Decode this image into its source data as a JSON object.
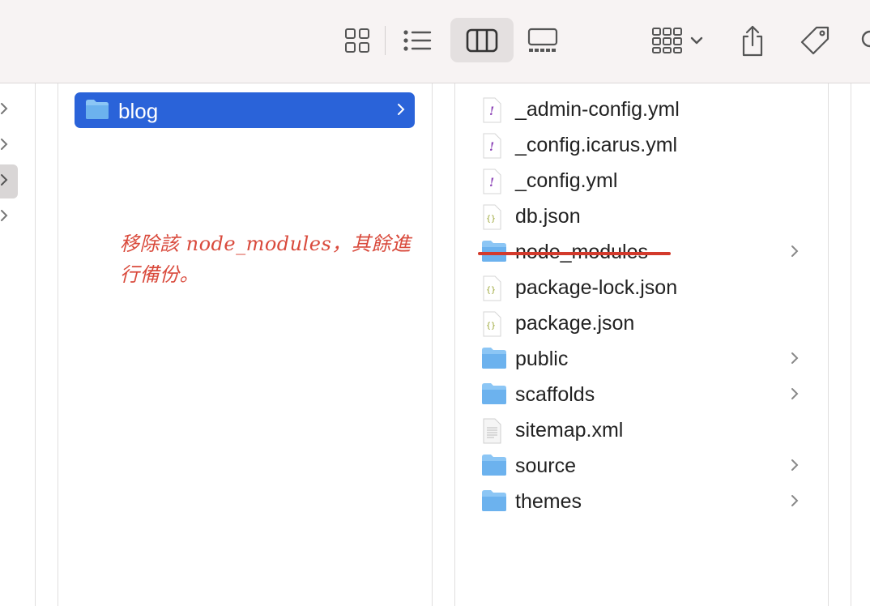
{
  "toolbar": {
    "buttons": [
      {
        "name": "icon-view-button",
        "icon": "grid-icon"
      },
      {
        "name": "list-view-button",
        "icon": "list-icon"
      },
      {
        "name": "column-view-button",
        "icon": "columns-icon",
        "active": true
      },
      {
        "name": "gallery-view-button",
        "icon": "gallery-icon"
      },
      {
        "name": "group-button",
        "icon": "group-grid-icon"
      },
      {
        "name": "share-button",
        "icon": "share-icon"
      },
      {
        "name": "tag-button",
        "icon": "tag-icon"
      }
    ]
  },
  "middle_column": {
    "selected_folder": "blog"
  },
  "annotation": {
    "line1": "移除該 node_modules，其餘進",
    "line2": "行備份。",
    "color": "#d94a3c"
  },
  "files": [
    {
      "name": "_admin-config.yml",
      "icon": "yml-file-icon",
      "folder": false
    },
    {
      "name": "_config.icarus.yml",
      "icon": "yml-file-icon",
      "folder": false
    },
    {
      "name": "_config.yml",
      "icon": "yml-file-icon",
      "folder": false
    },
    {
      "name": "db.json",
      "icon": "json-file-icon",
      "folder": false
    },
    {
      "name": "node_modules",
      "icon": "folder-icon",
      "folder": true,
      "struck": true
    },
    {
      "name": "package-lock.json",
      "icon": "json-file-icon",
      "folder": false
    },
    {
      "name": "package.json",
      "icon": "json-file-icon",
      "folder": false
    },
    {
      "name": "public",
      "icon": "folder-icon",
      "folder": true
    },
    {
      "name": "scaffolds",
      "icon": "folder-icon",
      "folder": true
    },
    {
      "name": "sitemap.xml",
      "icon": "xml-file-icon",
      "folder": false
    },
    {
      "name": "source",
      "icon": "folder-icon",
      "folder": true
    },
    {
      "name": "themes",
      "icon": "folder-icon",
      "folder": true
    }
  ],
  "colors": {
    "selection": "#2a63d9",
    "folder": "#6cb2ee",
    "strike": "#d33a2c"
  }
}
